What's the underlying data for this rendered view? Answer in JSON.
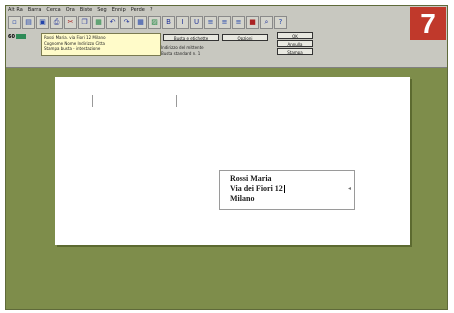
{
  "menu": [
    "Alt Ra",
    "Barra",
    "Cerca",
    "Ora",
    "Biste",
    "Seg",
    "Ennip",
    "Perde",
    "?"
  ],
  "toolbar_icons": [
    "new-icon",
    "open-icon",
    "save-icon",
    "print-icon",
    "cut-icon",
    "copy-icon",
    "paste-icon",
    "undo-icon",
    "redo-icon",
    "table-icon",
    "image-icon",
    "bold-icon",
    "italic-icon",
    "underline-icon",
    "align-left-icon",
    "align-center-icon",
    "align-right-icon",
    "color-icon",
    "zoom-icon",
    "help-icon"
  ],
  "step_badge": "7",
  "zoom_label": "60",
  "yellowbox": {
    "lines": [
      "Rossi Maria. via Fiori 12 Milano",
      "Cognome Nome Indirizzo Citta",
      "Stampa busta - intestazione"
    ]
  },
  "buttons": {
    "envelope": "Busta e etichette",
    "options": "Opzioni",
    "ok": "OK",
    "cancel": "Annulla",
    "print": "Stampa"
  },
  "info_lines": [
    "Indirizzo del mittente",
    "Busta standard n. 1"
  ],
  "address": {
    "line1": "Rossi Maria",
    "line2": "Via dei Fiori 12",
    "line3": "Milano"
  }
}
